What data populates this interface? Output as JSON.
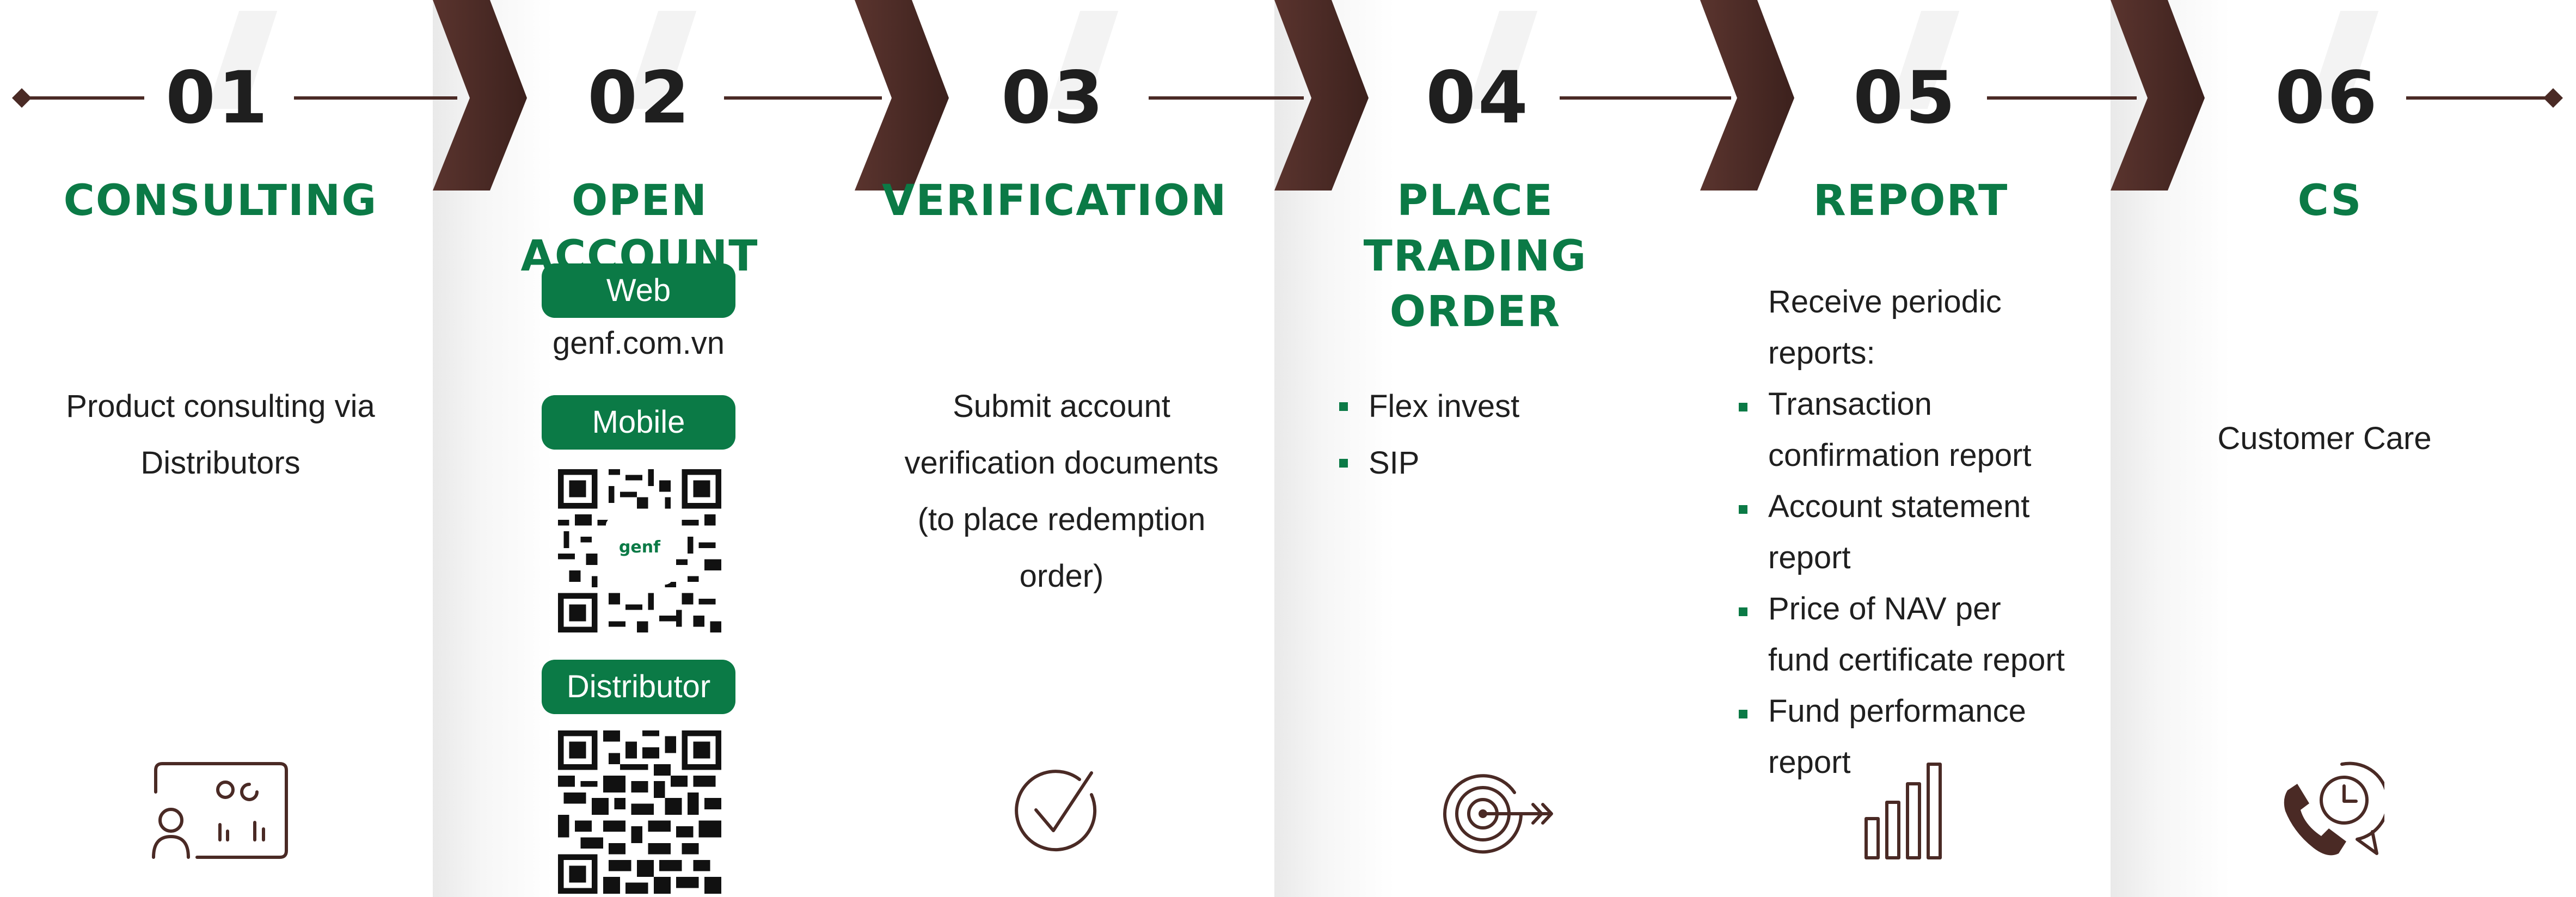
{
  "steps": [
    {
      "number": "01",
      "title_lines": [
        "CONSULTING"
      ],
      "description": "Product consulting via Distributors"
    },
    {
      "number": "02",
      "title_lines": [
        "OPEN ACCOUNT"
      ],
      "web_label": "Web",
      "web_url": "genf.com.vn",
      "mobile_label": "Mobile",
      "qr_logo_text": "genf",
      "distributor_label": "Distributor"
    },
    {
      "number": "03",
      "title_lines": [
        "VERIFICATION"
      ],
      "description": "Submit account verification documents (to place redemption order)"
    },
    {
      "number": "04",
      "title_lines": [
        "PLACE",
        "TRADING ORDER"
      ],
      "bullets": [
        "Flex invest",
        "SIP"
      ]
    },
    {
      "number": "05",
      "title_lines": [
        "REPORT"
      ],
      "intro": "Receive periodic reports:",
      "bullets": [
        "Transaction confirmation report",
        "Account statement report",
        "Price of NAV per fund certificate report",
        "Fund performance report"
      ]
    },
    {
      "number": "06",
      "title_lines": [
        "CS"
      ],
      "description": "Customer Care"
    }
  ],
  "icons": [
    "dashboard-user-icon",
    "checkmark-icon",
    "target-arrow-icon",
    "bar-chart-icon",
    "phone-clock-icon"
  ],
  "colors": {
    "accent_green": "#0b7a46",
    "chevron_brown": "#4a2a25",
    "icon_brown": "#4a2a25",
    "text_dark": "#1f1f1f"
  }
}
